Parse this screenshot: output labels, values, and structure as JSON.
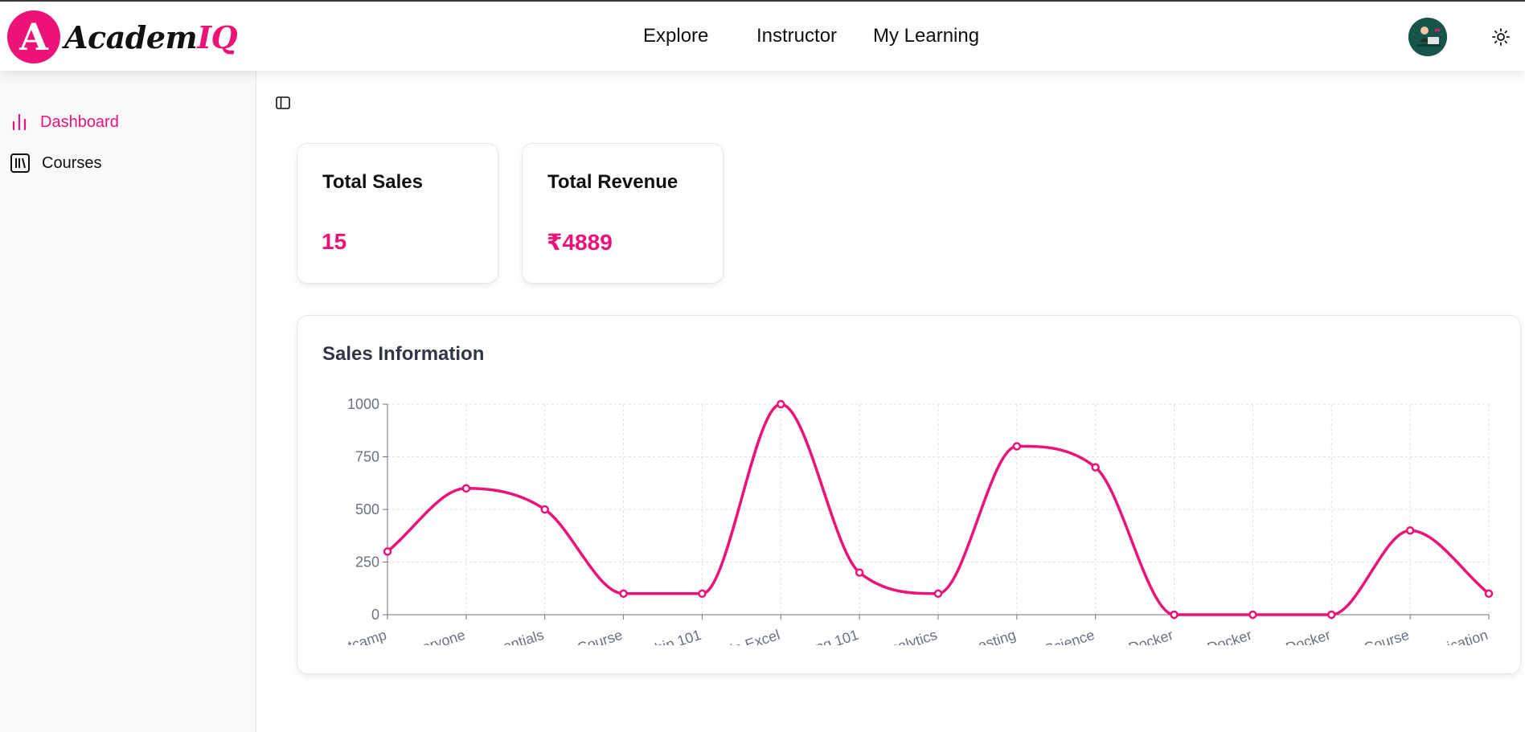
{
  "brand": {
    "letter": "A",
    "name_part1": "Academ",
    "name_part2": "IQ"
  },
  "nav": {
    "explore": "Explore",
    "instructor": "Instructor",
    "my_learning": "My Learning"
  },
  "sidebar": {
    "items": [
      {
        "label": "Dashboard",
        "icon": "bar-chart-icon",
        "active": true
      },
      {
        "label": "Courses",
        "icon": "library-icon",
        "active": false
      }
    ]
  },
  "cards": {
    "total_sales": {
      "title": "Total Sales",
      "value": "15"
    },
    "total_revenue": {
      "title": "Total Revenue",
      "value": "₹4889"
    }
  },
  "chart_title": "Sales Information",
  "colors": {
    "accent": "#ec1277",
    "grid": "#dcdfe4",
    "axis": "#6b7280"
  },
  "chart_data": {
    "type": "line",
    "title": "Sales Information",
    "categories": [
      "tcamp",
      "eryone",
      "entials",
      "Course",
      "hip 101",
      "in Excel",
      "ng 101",
      "nalytics",
      "esting",
      "Science",
      "Docker",
      "Docker",
      "Docker",
      "Course",
      "ication"
    ],
    "values": [
      300,
      600,
      500,
      100,
      100,
      1000,
      200,
      100,
      800,
      700,
      0,
      0,
      0,
      400,
      100
    ],
    "ylim": [
      0,
      1000
    ],
    "yticks": [
      0,
      250,
      500,
      750,
      1000
    ],
    "grid": true,
    "curve": "smooth",
    "legend": "none"
  }
}
